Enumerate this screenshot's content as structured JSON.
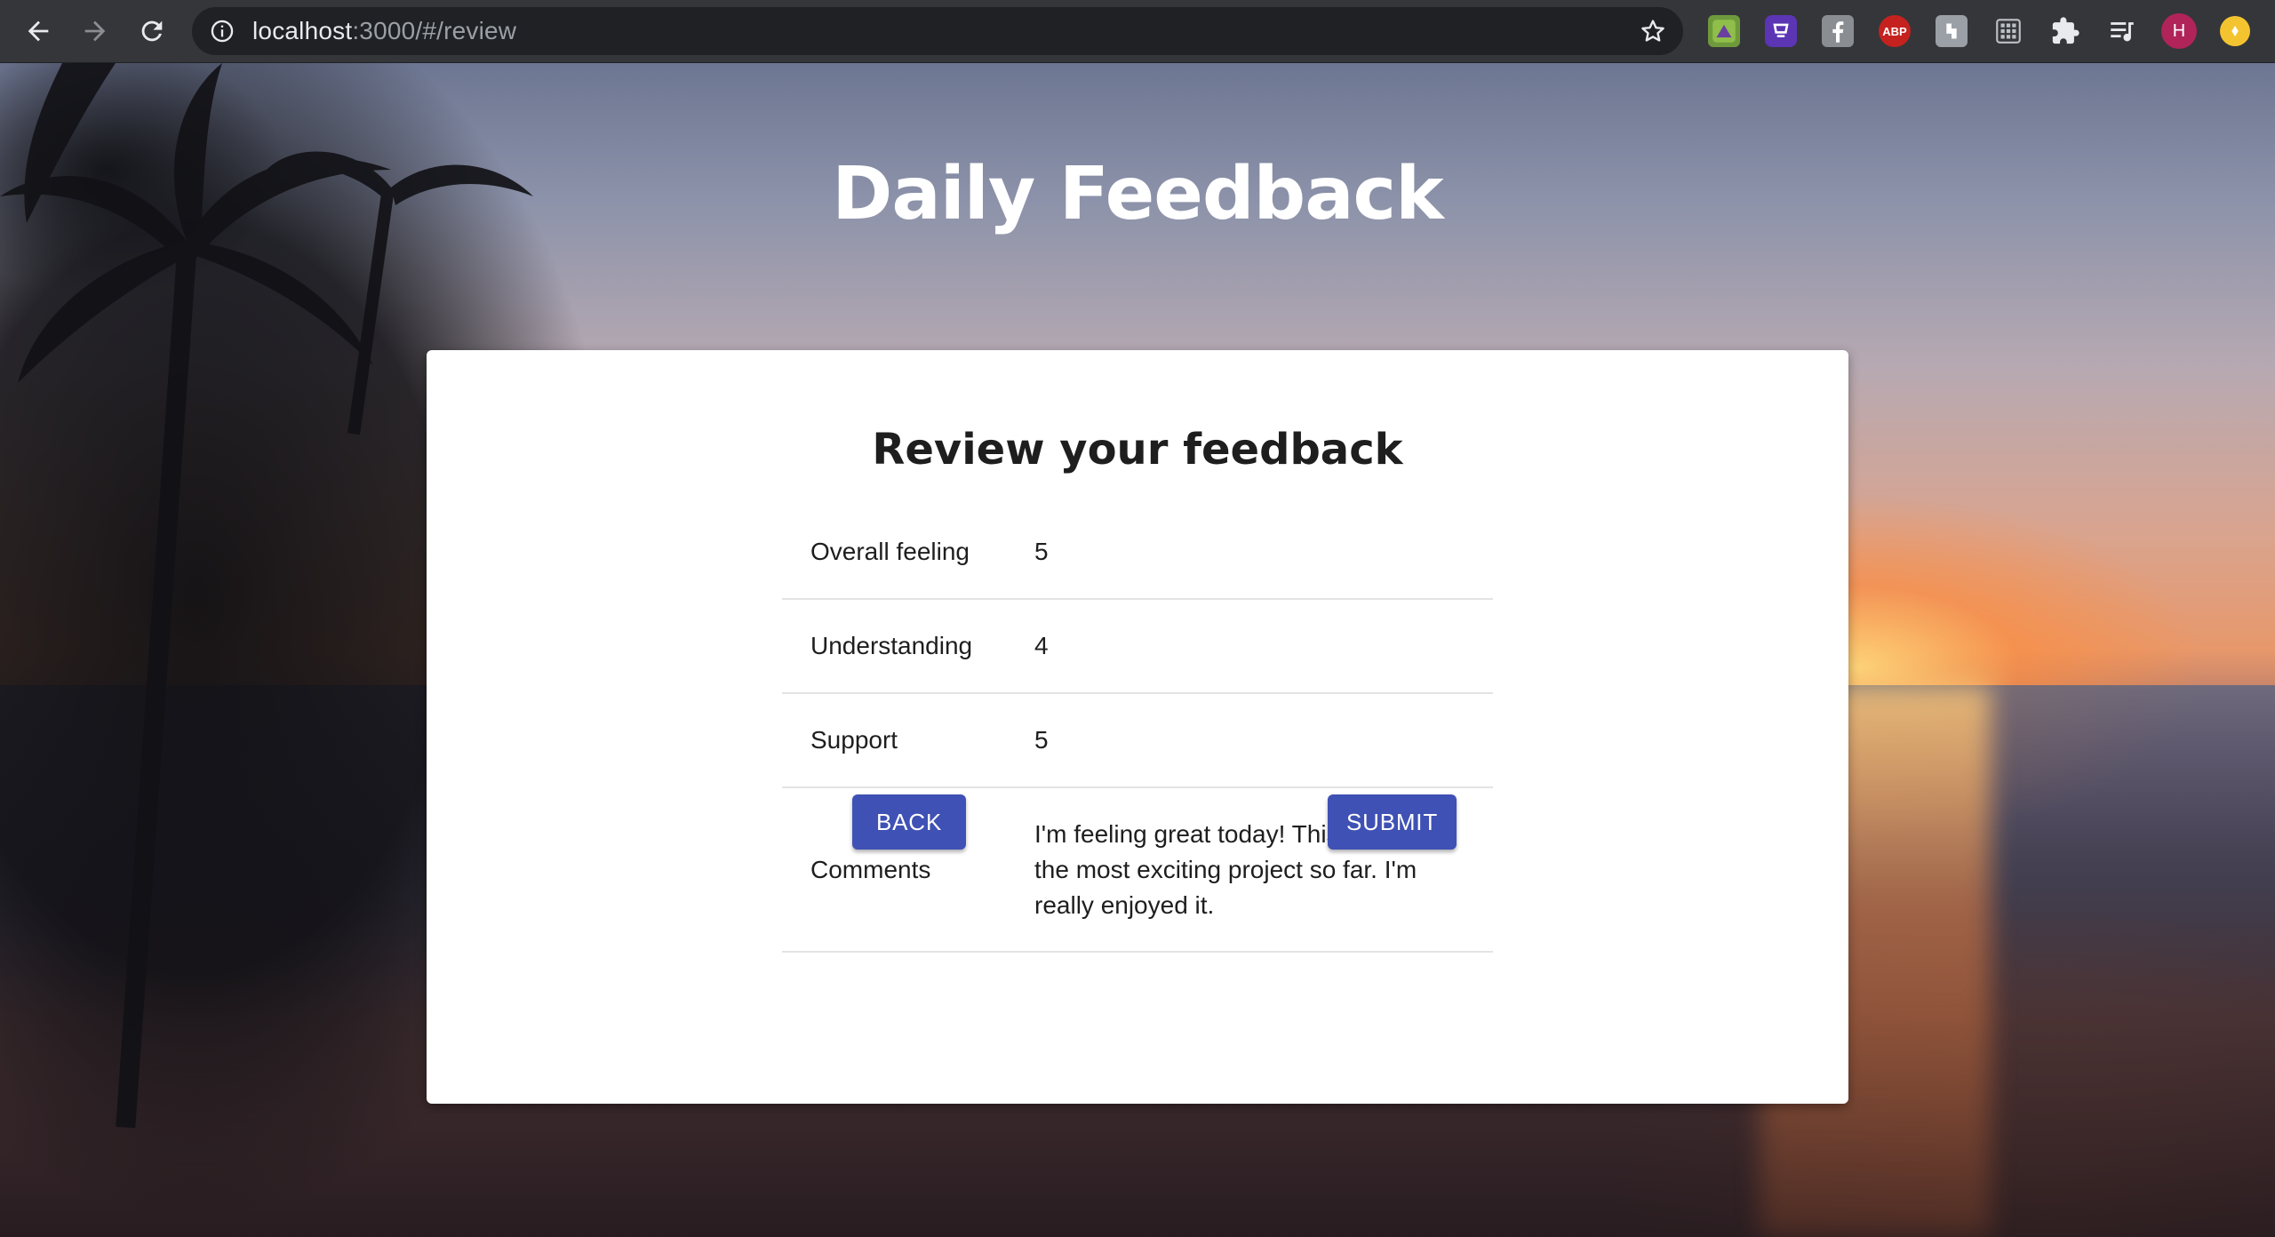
{
  "browser": {
    "url_host": "localhost",
    "url_path": ":3000/#/review",
    "profile_initial": "H",
    "extension_labels": {
      "abp": "ABP"
    }
  },
  "page": {
    "title": "Daily Feedback"
  },
  "review": {
    "heading": "Review your feedback",
    "rows": [
      {
        "label": "Overall feeling",
        "value": "5"
      },
      {
        "label": "Understanding",
        "value": "4"
      },
      {
        "label": "Support",
        "value": "5"
      },
      {
        "label": "Comments",
        "value": "I'm feeling great today! This has been the most exciting project so far. I'm really enjoyed it."
      }
    ],
    "back_label": "BACK",
    "submit_label": "SUBMIT"
  },
  "colors": {
    "button": "#3f51b5",
    "toolbar": "#35363a",
    "omnibox": "#202124"
  }
}
